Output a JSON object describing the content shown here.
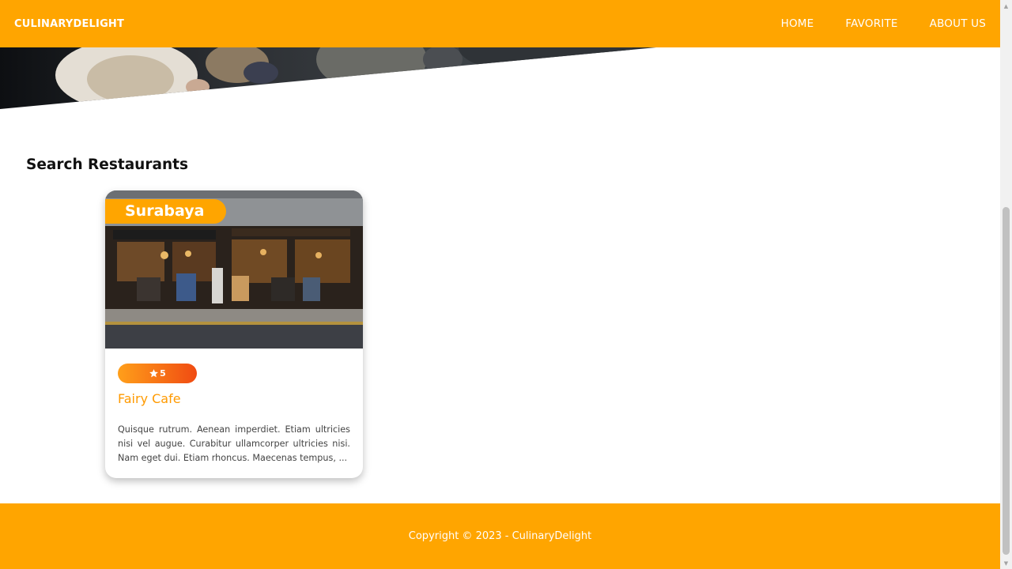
{
  "header": {
    "brand": "CULINARYDELIGHT",
    "nav": [
      "HOME",
      "FAVORITE",
      "ABOUT US"
    ]
  },
  "section": {
    "title": "Search Restaurants"
  },
  "card": {
    "city": "Surabaya",
    "rating": "5",
    "name": "Fairy Cafe",
    "description": "Quisque rutrum. Aenean imperdiet. Etiam ultricies nisi vel augue. Curabitur ullamcorper ultricies nisi. Nam eget dui. Etiam rhoncus. Maecenas tempus, ..."
  },
  "footer": {
    "copyright": "Copyright © 2023 - CulinaryDelight"
  },
  "colors": {
    "accent": "#ffa500",
    "rating_gradient_start": "#ff9f1a",
    "rating_gradient_end": "#f04b12",
    "name_text": "#ff9a00"
  },
  "icons": {
    "rating": "star-icon",
    "scroll_up": "arrow-up-icon",
    "scroll_down": "arrow-down-icon"
  }
}
